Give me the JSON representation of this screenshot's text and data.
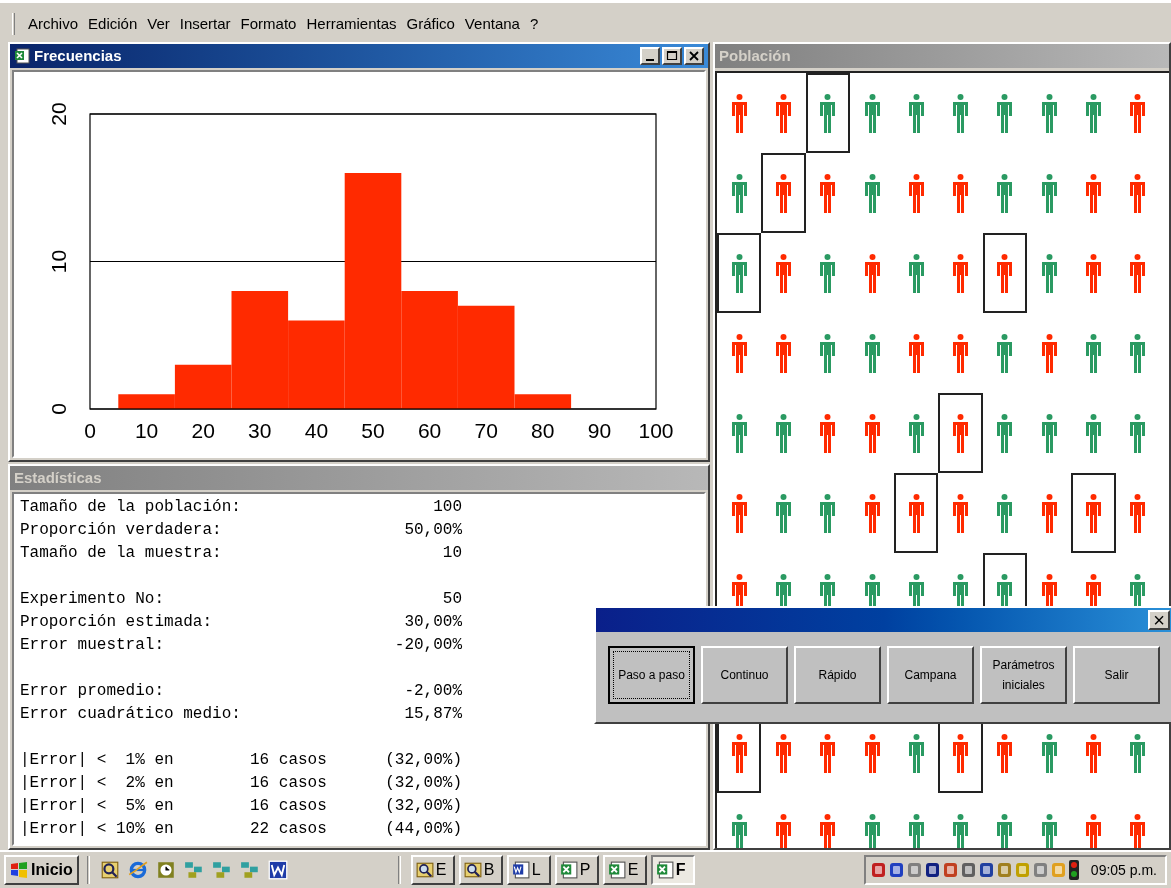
{
  "menu_bar": {
    "items": [
      "Archivo",
      "Edición",
      "Ver",
      "Insertar",
      "Formato",
      "Herramientas",
      "Gráfico",
      "Ventana",
      "?"
    ]
  },
  "frequency_window": {
    "title": "Frecuencias",
    "active": true,
    "chart_data": {
      "type": "bar",
      "x": [
        10,
        20,
        30,
        40,
        50,
        60,
        70,
        80
      ],
      "values": [
        1,
        3,
        8,
        6,
        16,
        8,
        7,
        1
      ],
      "xlim": [
        0,
        100
      ],
      "ylim": [
        0,
        20
      ],
      "xticks": [
        0,
        10,
        20,
        30,
        40,
        50,
        60,
        70,
        80,
        90,
        100
      ],
      "yticks": [
        0,
        10,
        20
      ]
    }
  },
  "statistics_window": {
    "title": "Estadísticas",
    "active": false,
    "groups": [
      [
        {
          "kind": "pair",
          "label": "Tamaño de la población:",
          "value": "100"
        },
        {
          "kind": "pair",
          "label": "Proporción verdadera:",
          "value": "50,00%"
        },
        {
          "kind": "pair",
          "label": "Tamaño de la muestra:",
          "value": "10"
        }
      ],
      [
        {
          "kind": "pair",
          "label": "Experimento No:",
          "value": "50"
        },
        {
          "kind": "pair",
          "label": "Proporción estimada:",
          "value": "30,00%"
        },
        {
          "kind": "pair",
          "label": "Error muestral:",
          "value": "-20,00%"
        }
      ],
      [
        {
          "kind": "pair",
          "label": "Error promedio:",
          "value": "-2,00%"
        },
        {
          "kind": "pair",
          "label": "Error cuadrático medio:",
          "value": "15,87%"
        }
      ],
      [
        {
          "kind": "triple",
          "label": "|Error| <  1% en",
          "count": "16 casos",
          "value": "(32,00%)"
        },
        {
          "kind": "triple",
          "label": "|Error| <  2% en",
          "count": "16 casos",
          "value": "(32,00%)"
        },
        {
          "kind": "triple",
          "label": "|Error| <  5% en",
          "count": "16 casos",
          "value": "(32,00%)"
        },
        {
          "kind": "triple",
          "label": "|Error| < 10% en",
          "count": "22 casos",
          "value": "(44,00%)"
        }
      ]
    ]
  },
  "population_window": {
    "title": "Población",
    "active": false,
    "rows": [
      {
        "kind": "figures",
        "cells": [
          {
            "color": "#ff2a00",
            "selected": false
          },
          {
            "color": "#ff2a00",
            "selected": false
          },
          {
            "color": "#2a9a62",
            "selected": true
          },
          {
            "color": "#2a9a62",
            "selected": false
          },
          {
            "color": "#2a9a62",
            "selected": false
          },
          {
            "color": "#2a9a62",
            "selected": false
          },
          {
            "color": "#2a9a62",
            "selected": false
          },
          {
            "color": "#2a9a62",
            "selected": false
          },
          {
            "color": "#2a9a62",
            "selected": false
          },
          {
            "color": "#ff2a00",
            "selected": false
          }
        ]
      },
      {
        "kind": "figures",
        "cells": [
          {
            "color": "#2a9a62",
            "selected": false
          },
          {
            "color": "#ff2a00",
            "selected": true
          },
          {
            "color": "#ff2a00",
            "selected": false
          },
          {
            "color": "#2a9a62",
            "selected": false
          },
          {
            "color": "#ff2a00",
            "selected": false
          },
          {
            "color": "#ff2a00",
            "selected": false
          },
          {
            "color": "#2a9a62",
            "selected": false
          },
          {
            "color": "#2a9a62",
            "selected": false
          },
          {
            "color": "#ff2a00",
            "selected": false
          },
          {
            "color": "#ff2a00",
            "selected": false
          }
        ]
      },
      {
        "kind": "figures",
        "cells": [
          {
            "color": "#2a9a62",
            "selected": true
          },
          {
            "color": "#ff2a00",
            "selected": false
          },
          {
            "color": "#2a9a62",
            "selected": false
          },
          {
            "color": "#ff2a00",
            "selected": false
          },
          {
            "color": "#2a9a62",
            "selected": false
          },
          {
            "color": "#ff2a00",
            "selected": false
          },
          {
            "color": "#ff2a00",
            "selected": true
          },
          {
            "color": "#2a9a62",
            "selected": false
          },
          {
            "color": "#ff2a00",
            "selected": false
          },
          {
            "color": "#ff2a00",
            "selected": false
          }
        ]
      },
      {
        "kind": "figures",
        "cells": [
          {
            "color": "#ff2a00",
            "selected": false
          },
          {
            "color": "#ff2a00",
            "selected": false
          },
          {
            "color": "#2a9a62",
            "selected": false
          },
          {
            "color": "#2a9a62",
            "selected": false
          },
          {
            "color": "#ff2a00",
            "selected": false
          },
          {
            "color": "#ff2a00",
            "selected": false
          },
          {
            "color": "#2a9a62",
            "selected": false
          },
          {
            "color": "#ff2a00",
            "selected": false
          },
          {
            "color": "#2a9a62",
            "selected": false
          },
          {
            "color": "#2a9a62",
            "selected": false
          }
        ]
      },
      {
        "kind": "figures",
        "cells": [
          {
            "color": "#2a9a62",
            "selected": false
          },
          {
            "color": "#2a9a62",
            "selected": false
          },
          {
            "color": "#ff2a00",
            "selected": false
          },
          {
            "color": "#ff2a00",
            "selected": false
          },
          {
            "color": "#2a9a62",
            "selected": false
          },
          {
            "color": "#ff2a00",
            "selected": true
          },
          {
            "color": "#2a9a62",
            "selected": false
          },
          {
            "color": "#2a9a62",
            "selected": false
          },
          {
            "color": "#2a9a62",
            "selected": false
          },
          {
            "color": "#2a9a62",
            "selected": false
          }
        ]
      },
      {
        "kind": "figures",
        "cells": [
          {
            "color": "#ff2a00",
            "selected": false
          },
          {
            "color": "#2a9a62",
            "selected": false
          },
          {
            "color": "#2a9a62",
            "selected": false
          },
          {
            "color": "#ff2a00",
            "selected": false
          },
          {
            "color": "#ff2a00",
            "selected": true
          },
          {
            "color": "#ff2a00",
            "selected": false
          },
          {
            "color": "#2a9a62",
            "selected": false
          },
          {
            "color": "#ff2a00",
            "selected": false
          },
          {
            "color": "#ff2a00",
            "selected": true
          },
          {
            "color": "#ff2a00",
            "selected": false
          }
        ]
      },
      {
        "kind": "figures",
        "cells": [
          {
            "color": "#ff2a00",
            "selected": false
          },
          {
            "color": "#2a9a62",
            "selected": false
          },
          {
            "color": "#2a9a62",
            "selected": false
          },
          {
            "color": "#2a9a62",
            "selected": false
          },
          {
            "color": "#2a9a62",
            "selected": false
          },
          {
            "color": "#2a9a62",
            "selected": false
          },
          {
            "color": "#2a9a62",
            "selected": true
          },
          {
            "color": "#ff2a00",
            "selected": false
          },
          {
            "color": "#ff2a00",
            "selected": false
          },
          {
            "color": "#2a9a62",
            "selected": false
          }
        ]
      },
      {
        "kind": "covered"
      },
      {
        "kind": "figures",
        "cells": [
          {
            "color": "#ff2a00",
            "selected": true
          },
          {
            "color": "#ff2a00",
            "selected": false
          },
          {
            "color": "#ff2a00",
            "selected": false
          },
          {
            "color": "#ff2a00",
            "selected": false
          },
          {
            "color": "#2a9a62",
            "selected": false
          },
          {
            "color": "#ff2a00",
            "selected": true
          },
          {
            "color": "#ff2a00",
            "selected": false
          },
          {
            "color": "#2a9a62",
            "selected": false
          },
          {
            "color": "#ff2a00",
            "selected": false
          },
          {
            "color": "#2a9a62",
            "selected": false
          }
        ]
      },
      {
        "kind": "figures",
        "cells": [
          {
            "color": "#2a9a62",
            "selected": false
          },
          {
            "color": "#ff2a00",
            "selected": false
          },
          {
            "color": "#ff2a00",
            "selected": false
          },
          {
            "color": "#2a9a62",
            "selected": false
          },
          {
            "color": "#2a9a62",
            "selected": false
          },
          {
            "color": "#2a9a62",
            "selected": false
          },
          {
            "color": "#2a9a62",
            "selected": false
          },
          {
            "color": "#2a9a62",
            "selected": false
          },
          {
            "color": "#ff2a00",
            "selected": false
          },
          {
            "color": "#ff2a00",
            "selected": false
          }
        ]
      }
    ]
  },
  "dialog": {
    "close": "×",
    "buttons": [
      {
        "label": "Paso a paso",
        "focused": true
      },
      {
        "label": "Continuo",
        "focused": false
      },
      {
        "label": "Rápido",
        "focused": false
      },
      {
        "label": "Campana",
        "focused": false
      },
      {
        "label": "Parámetros iniciales",
        "focused": false
      },
      {
        "label": "Salir",
        "focused": false
      }
    ]
  },
  "taskbar": {
    "start": "Inicio",
    "tasks": [
      {
        "kind": "explorer",
        "label": "E",
        "selected": false
      },
      {
        "kind": "explorer",
        "label": "B",
        "selected": false
      },
      {
        "kind": "word",
        "label": "L",
        "selected": false
      },
      {
        "kind": "excel",
        "label": "P",
        "selected": false
      },
      {
        "kind": "excel",
        "label": "E",
        "selected": false
      },
      {
        "kind": "excel",
        "label": "F",
        "selected": true
      }
    ],
    "clock": "09:05 p.m."
  }
}
